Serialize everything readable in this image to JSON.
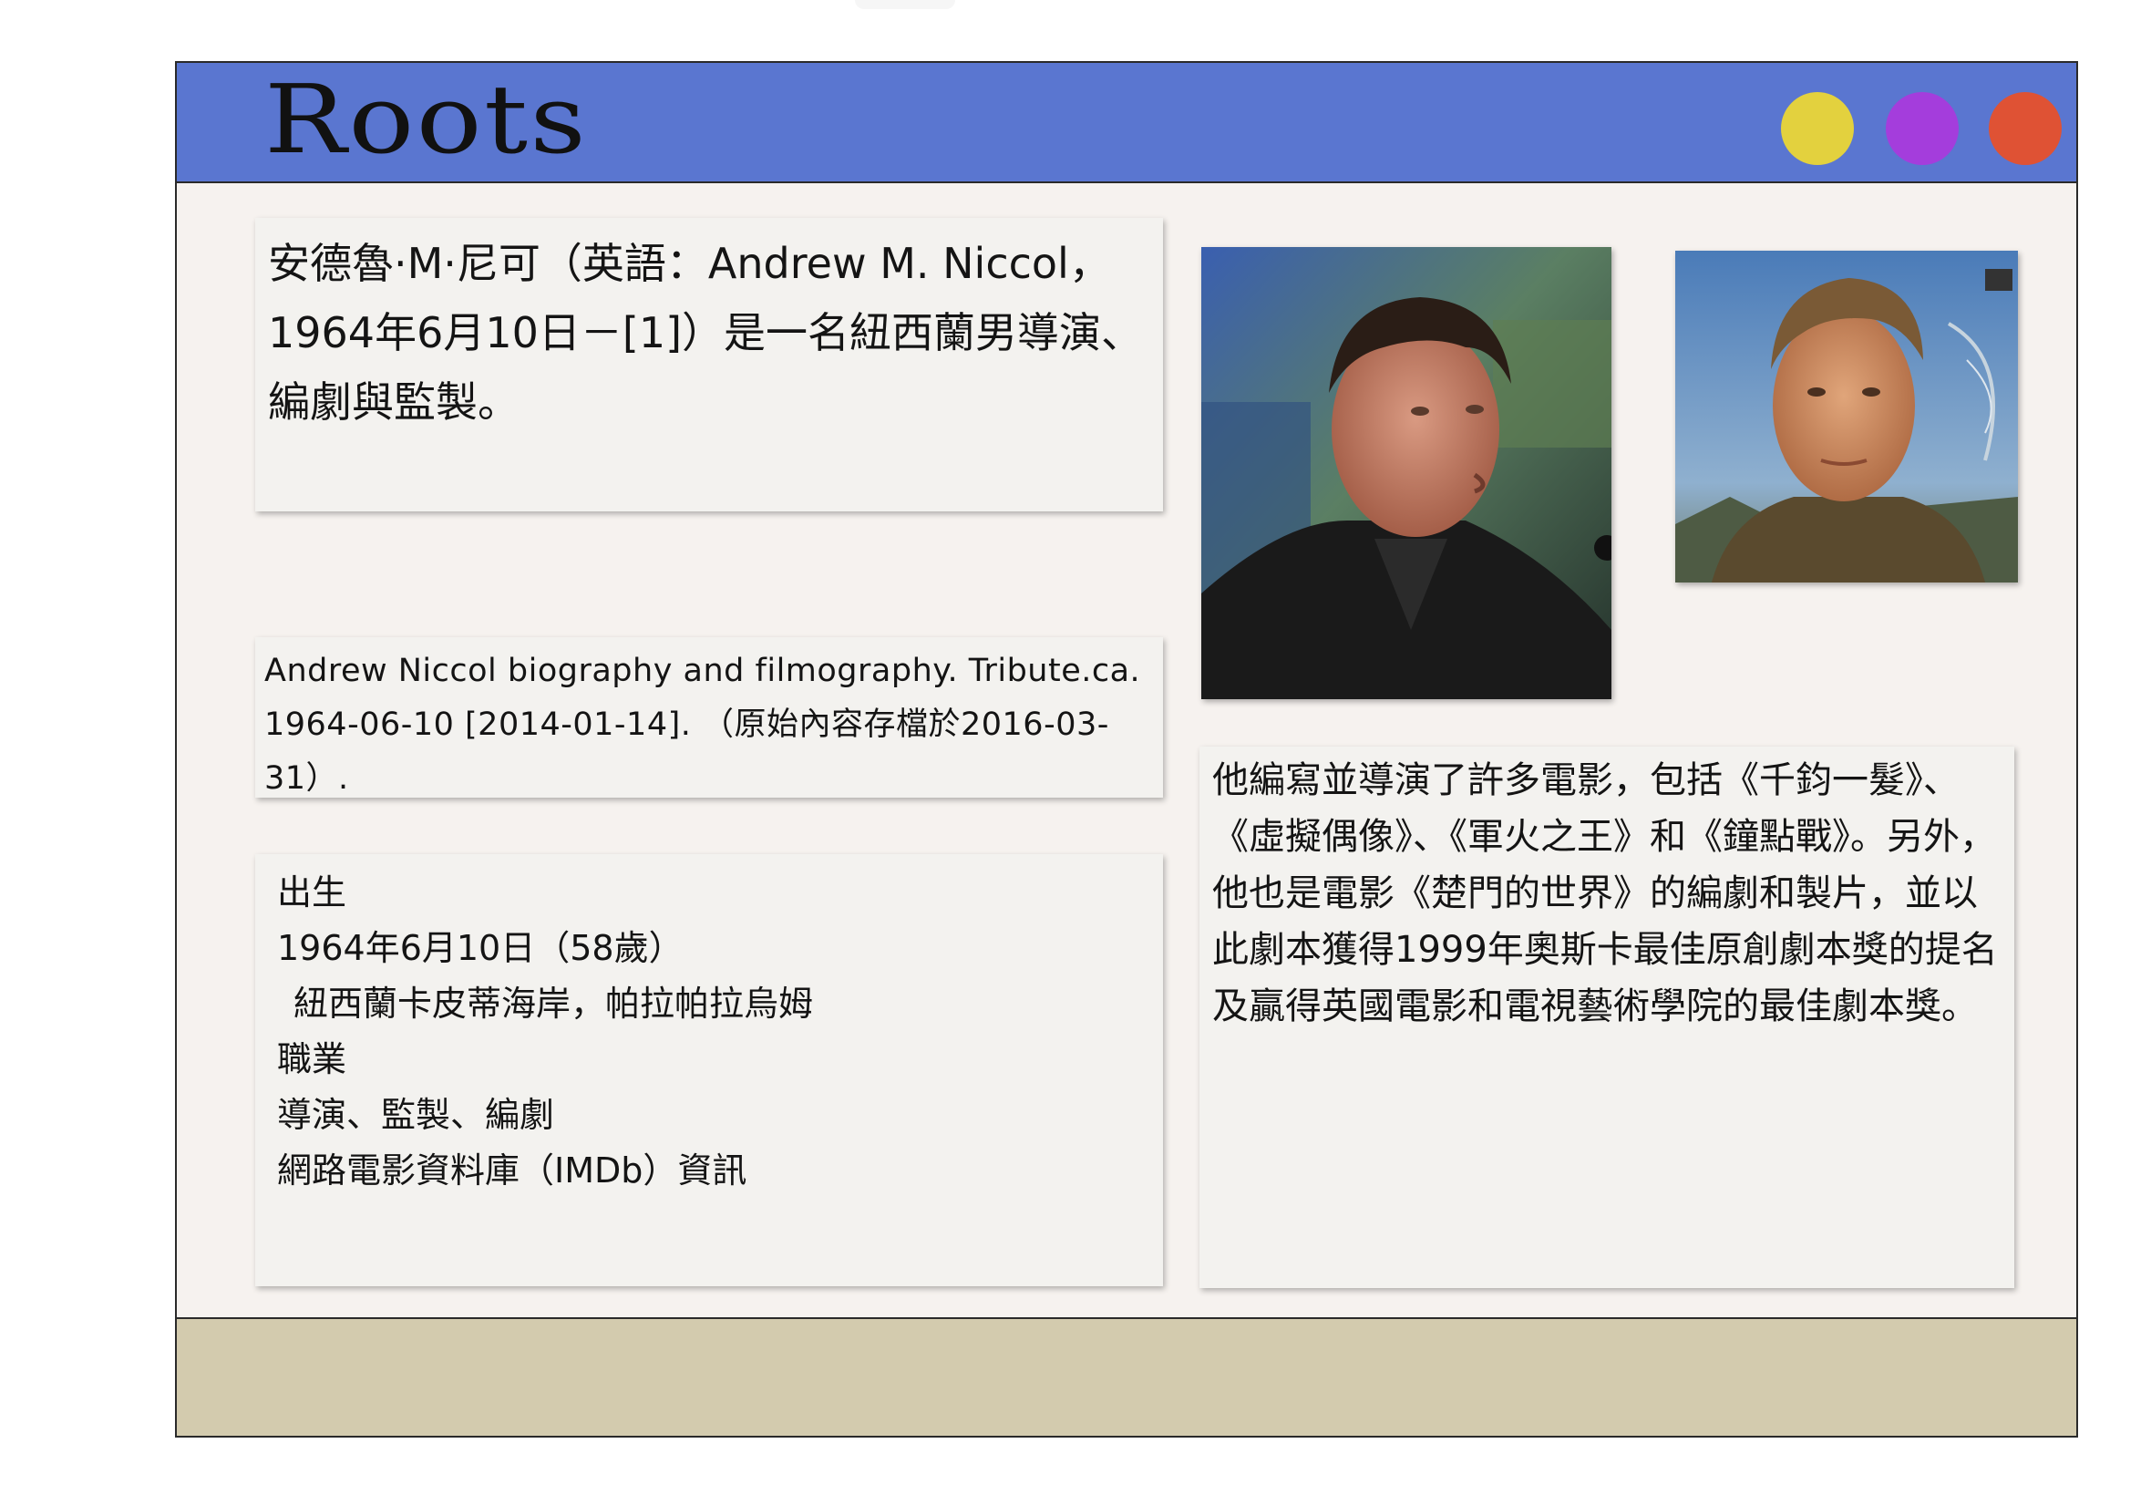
{
  "window": {
    "title": "Roots",
    "controls": [
      {
        "name": "yellow",
        "color": "#e3d13e"
      },
      {
        "name": "purple",
        "color": "#a43ddc"
      },
      {
        "name": "red",
        "color": "#df5234"
      }
    ]
  },
  "intro": {
    "text": "安德魯·M·尼可（英語：Andrew M. Niccol，1964年6月10日－[1]）是一名紐西蘭男導演、編劇與監製。"
  },
  "reference": {
    "text": "Andrew Niccol biography and filmography. Tribute.ca. 1964-06-10 [2014-01-14]. （原始內容存檔於2016-03-31）."
  },
  "info": {
    "born_label": "出生",
    "born_date": "1964年6月10日（58歲）",
    "born_place": "紐西蘭卡皮蒂海岸，帕拉帕拉烏姆",
    "occupation_label": "職業",
    "occupation_value": "導演、監製、編劇",
    "imdb_label": "網路電影資料庫（IMDb）資訊"
  },
  "career": {
    "text": "他編寫並導演了許多電影，包括《千鈞一髮》、《虛擬偶像》、《軍火之王》和《鐘點戰》。另外，他也是電影《楚門的世界》的編劇和製片，並以此劇本獲得1999年奧斯卡最佳原創劇本獎的提名及贏得英國電影和電視藝術學院的最佳劇本獎。"
  }
}
